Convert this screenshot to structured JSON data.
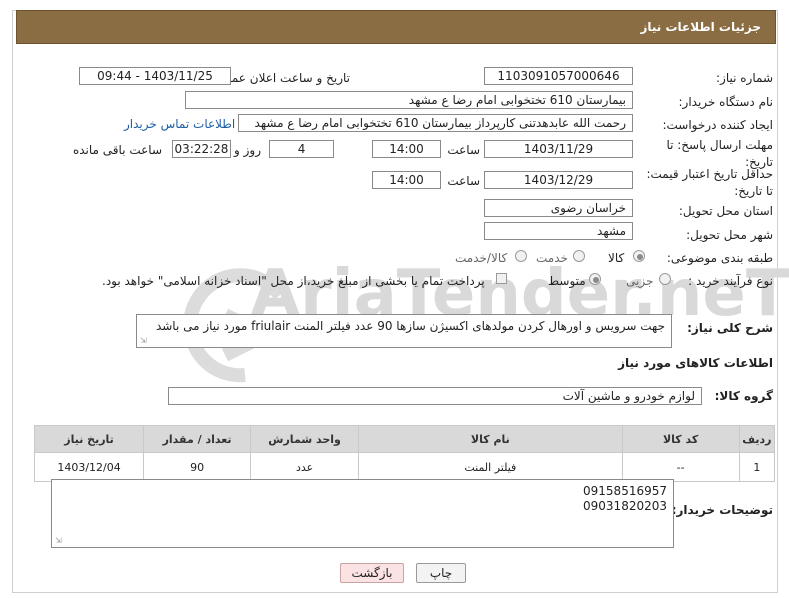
{
  "header": {
    "title": "جزئیات اطلاعات نیاز"
  },
  "fields": {
    "need_number_label": "شماره نیاز:",
    "need_number": "1103091057000646",
    "announce_label": "تاریخ و ساعت اعلان عمومی:",
    "announce_value": "1403/11/25 - 09:44",
    "buyer_org_label": "نام دستگاه خریدار:",
    "buyer_org": "بیمارستان 610 تختخوابی امام رضا ع  مشهد",
    "requester_label": "ایجاد کننده درخواست:",
    "requester": "رحمت الله عابدهدتنی کارپرداز بیمارستان 610 تختخوابی امام رضا ع  مشهد",
    "contact_link": "اطلاعات تماس خریدار",
    "reply_deadline_label": "مهلت ارسال پاسخ: تا تاریخ:",
    "reply_date": "1403/11/29",
    "time_label": "ساعت",
    "reply_time": "14:00",
    "days_value": "4",
    "days_label": "روز و",
    "remaining_time": "03:22:28",
    "remaining_label": "ساعت باقی مانده",
    "price_validity_label": "حداقل تاریخ اعتبار قیمت: تا تاریخ:",
    "price_date": "1403/12/29",
    "price_time_label": "ساعت",
    "price_time": "14:00",
    "province_label": "استان محل تحویل:",
    "province": "خراسان رضوی",
    "city_label": "شهر محل تحویل:",
    "city": "مشهد",
    "category_label": "طبقه بندی موضوعی:",
    "category_options": [
      "کالا",
      "خدمت",
      "کالا/خدمت"
    ],
    "category_selected": "کالا",
    "process_label": "نوع فرآیند خرید :",
    "process_options": [
      "جزیی",
      "متوسط"
    ],
    "process_selected": "متوسط",
    "payment_note": "پرداخت تمام یا بخشی از مبلغ خرید،از محل \"اسناد خزانه اسلامی\" خواهد بود."
  },
  "description": {
    "label": "شرح کلی نیاز:",
    "text": "جهت سرویس و اورهال کردن مولدهای اکسیژن سازها 90 عدد فیلتر المنت friulair مورد نیاز می باشد"
  },
  "goods": {
    "section_title": "اطلاعات کالاهای مورد نیاز",
    "group_label": "گروه کالا:",
    "group_value": "لوازم خودرو و ماشین آلات",
    "table_headers": [
      "ردیف",
      "کد کالا",
      "نام کالا",
      "واحد شمارش",
      "تعداد / مقدار",
      "تاریخ نیاز"
    ],
    "rows": [
      {
        "row": "1",
        "code": "--",
        "name": "فیلتر المنت",
        "unit": "عدد",
        "qty": "90",
        "date": "1403/12/04"
      }
    ]
  },
  "buyer_notes": {
    "label": "توضیحات خریدار:",
    "line1": "09158516957",
    "line2": "09031820203"
  },
  "buttons": {
    "print": "چاپ",
    "back": "بازگشت"
  },
  "watermark_text": "AriaTender.neT"
}
